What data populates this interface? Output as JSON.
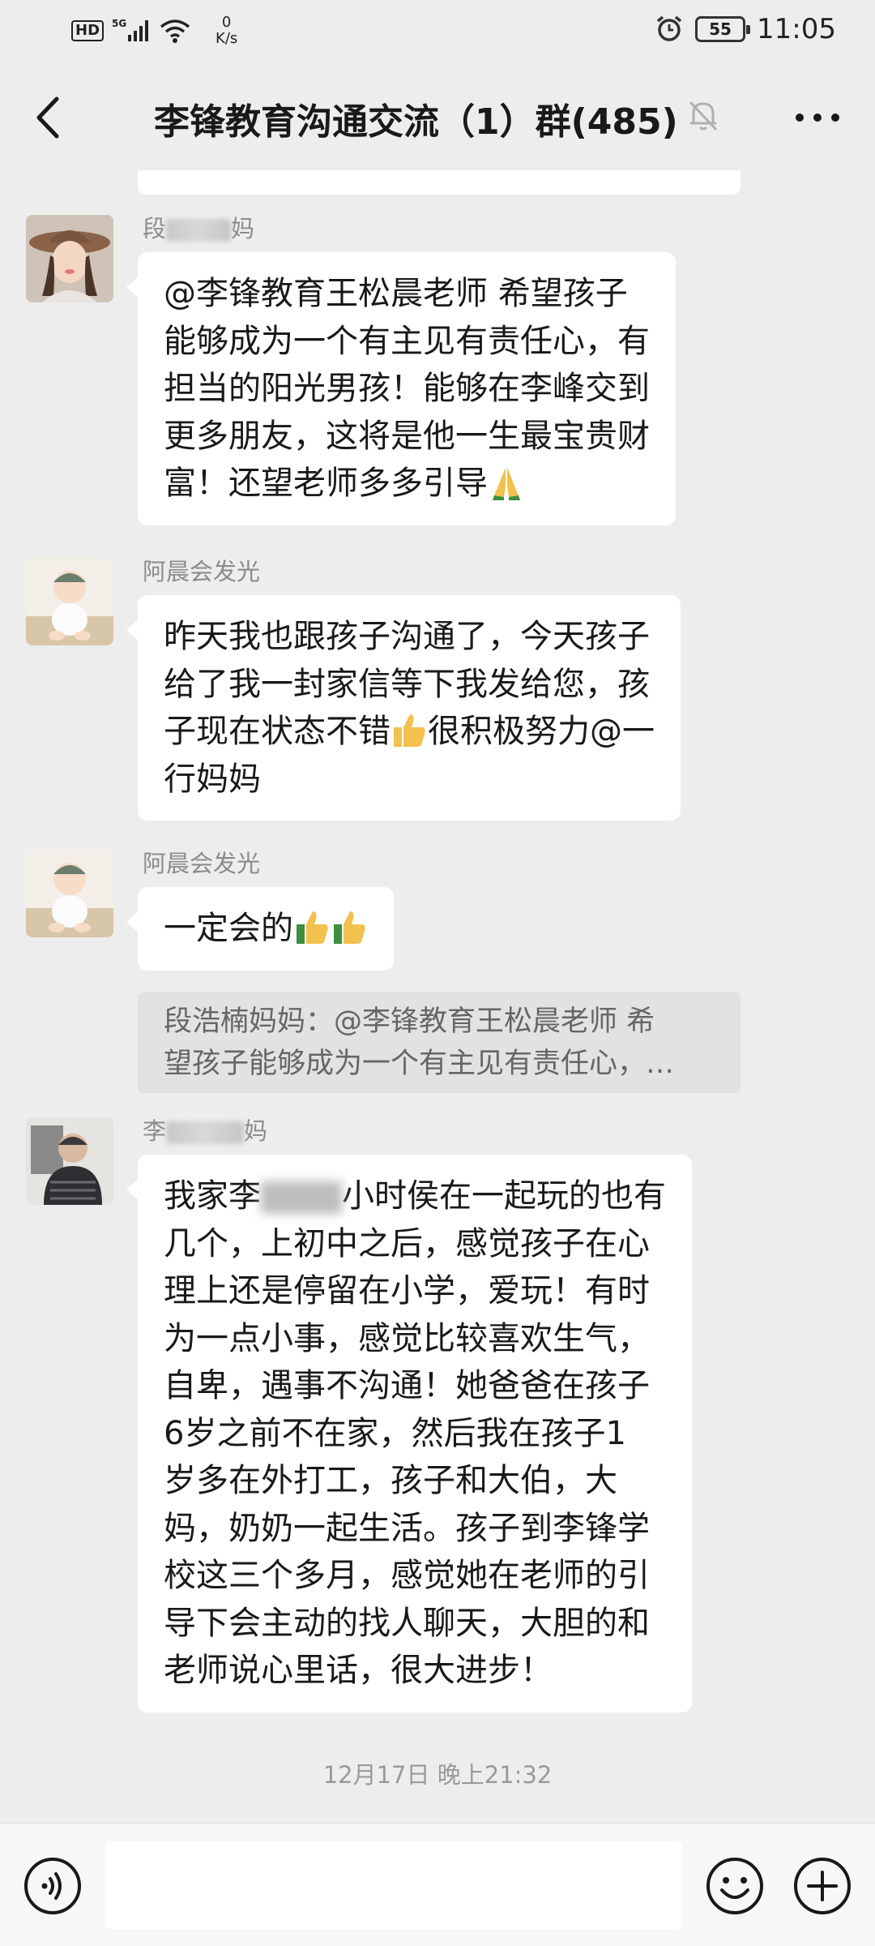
{
  "status_bar": {
    "hd": "HD",
    "network": "5G",
    "net_speed_value": "0",
    "net_speed_unit": "K/s",
    "battery": "55",
    "time": "11:05"
  },
  "header": {
    "title": "李锋教育沟通交流（1）群(485)"
  },
  "messages": [
    {
      "sender": "段",
      "sender_suffix": "妈",
      "lines": [
        "@李锋教育王松晨老师  希望孩子",
        "能够成为一个有主见有责任心，有",
        "担当的阳光男孩！能够在李峰交到",
        "更多朋友，这将是他一生最宝贵财",
        "富！还望老师多多引导"
      ]
    },
    {
      "sender": "阿晨会发光",
      "lines": [
        "昨天我也跟孩子沟通了，今天孩子",
        "给了我一封家信等下我发给您，孩",
        "子现在状态不错",
        "很积极努力@一",
        "行妈妈"
      ]
    },
    {
      "sender": "阿晨会发光",
      "text": "一定会的",
      "quote_line1": "段浩楠妈妈：@李锋教育王松晨老师 希",
      "quote_line2": "望孩子能够成为一个有主见有责任心，…"
    },
    {
      "sender": "李",
      "sender_suffix": "妈",
      "lines": [
        "我家李",
        "小时侯在一起玩的也有",
        "几个，上初中之后，感觉孩子在心",
        "理上还是停留在小学，爱玩！有时",
        "为一点小事，感觉比较喜欢生气，",
        "自卑，遇事不沟通！她爸爸在孩子",
        "6岁之前不在家，然后我在孩子1",
        "岁多在外打工，孩子和大伯，大",
        "妈，奶奶一起生活。孩子到李锋学",
        "校这三个多月，感觉她在老师的引",
        "导下会主动的找人聊天，大胆的和",
        "老师说心里话，很大进步！"
      ]
    }
  ],
  "timestamp": "12月17日 晚上21:32",
  "icons": [
    "back-arrow-icon",
    "mute-bell-icon",
    "more-icon",
    "voice-icon",
    "emoji-icon",
    "plus-icon",
    "praying-hands-emoji",
    "thumbs-up-emoji"
  ],
  "colors": {
    "background": "#ededed",
    "bubble": "#ffffff",
    "quote": "#e2e2e2",
    "sender": "#8c8c8c"
  }
}
